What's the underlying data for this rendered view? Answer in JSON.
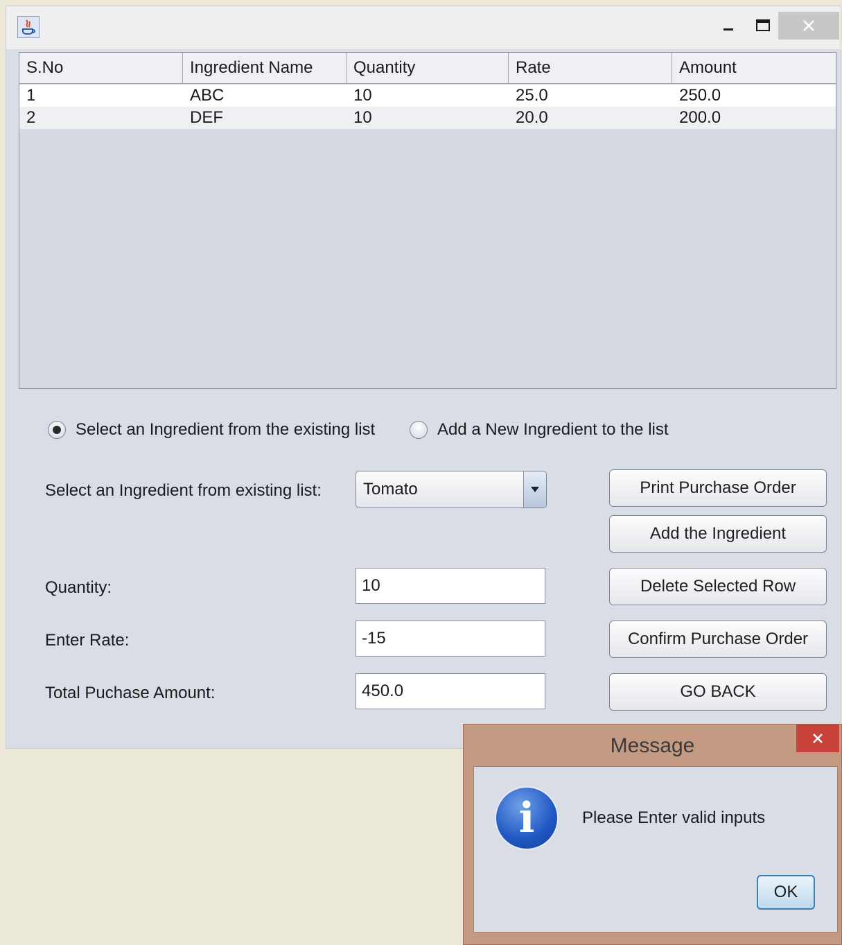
{
  "table": {
    "columns": [
      "S.No",
      "Ingredient Name",
      "Quantity",
      "Rate",
      "Amount"
    ],
    "rows": [
      [
        "1",
        "ABC",
        "10",
        "25.0",
        "250.0"
      ],
      [
        "2",
        "DEF",
        "10",
        "20.0",
        "200.0"
      ]
    ]
  },
  "mode": {
    "existing_label": "Select an Ingredient from the existing list",
    "new_label": "Add a New Ingredient to the list",
    "selected": "existing"
  },
  "form": {
    "ingredient_label": "Select an Ingredient from existing list:",
    "ingredient_value": "Tomato",
    "quantity_label": "Quantity:",
    "quantity_value": "10",
    "rate_label": "Enter Rate:",
    "rate_value": "-15",
    "total_label": "Total Puchase Amount:",
    "total_value": "450.0"
  },
  "buttons": {
    "print": "Print Purchase Order",
    "add": "Add the Ingredient",
    "delete": "Delete Selected Row",
    "confirm": "Confirm Purchase Order",
    "back": "GO BACK"
  },
  "dialog": {
    "title": "Message",
    "message": "Please Enter valid inputs",
    "ok": "OK"
  },
  "icons": {
    "app": "java-app-icon",
    "info": "info-icon",
    "dropdown": "triangle-down-icon"
  },
  "colors": {
    "window_bg": "#d9dde6",
    "dialog_frame": "#c49a82",
    "close_red": "#c8413a"
  }
}
